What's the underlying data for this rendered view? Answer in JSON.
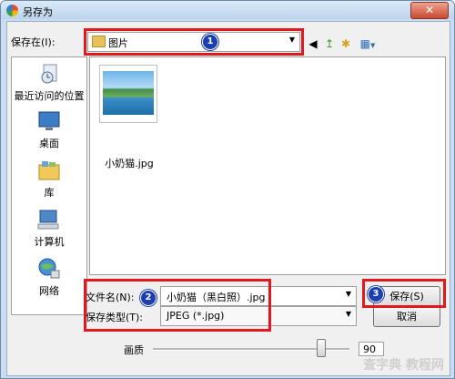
{
  "window": {
    "title": "另存为",
    "close": "✕"
  },
  "toolbar": {
    "save_in_label": "保存在(I):",
    "location": "图片",
    "buttons": [
      {
        "name": "back-icon",
        "glyph": "◀"
      },
      {
        "name": "up-folder-icon",
        "glyph": "↥"
      },
      {
        "name": "new-folder-icon",
        "glyph": "✱"
      },
      {
        "name": "view-menu-icon",
        "glyph": "▦"
      }
    ]
  },
  "places": [
    {
      "label": "最近访问的位置",
      "icon": "recent-places-icon"
    },
    {
      "label": "桌面",
      "icon": "desktop-icon"
    },
    {
      "label": "库",
      "icon": "libraries-icon"
    },
    {
      "label": "计算机",
      "icon": "computer-icon"
    },
    {
      "label": "网络",
      "icon": "network-icon"
    }
  ],
  "files": [
    {
      "name": "小奶猫.jpg"
    }
  ],
  "form": {
    "filename_label": "文件名(N):",
    "filename_value": "小奶猫（黑白照）.jpg",
    "filetype_label": "保存类型(T):",
    "filetype_value": "JPEG (*.jpg)"
  },
  "buttons": {
    "save": "保存(S)",
    "cancel": "取消"
  },
  "quality": {
    "label": "画质",
    "value": "90"
  },
  "annotations": [
    "1",
    "2",
    "3"
  ],
  "watermark": "查字典 教程网",
  "colors": {
    "annotation_box": "#e0191d",
    "badge": "#1b3fb0"
  }
}
